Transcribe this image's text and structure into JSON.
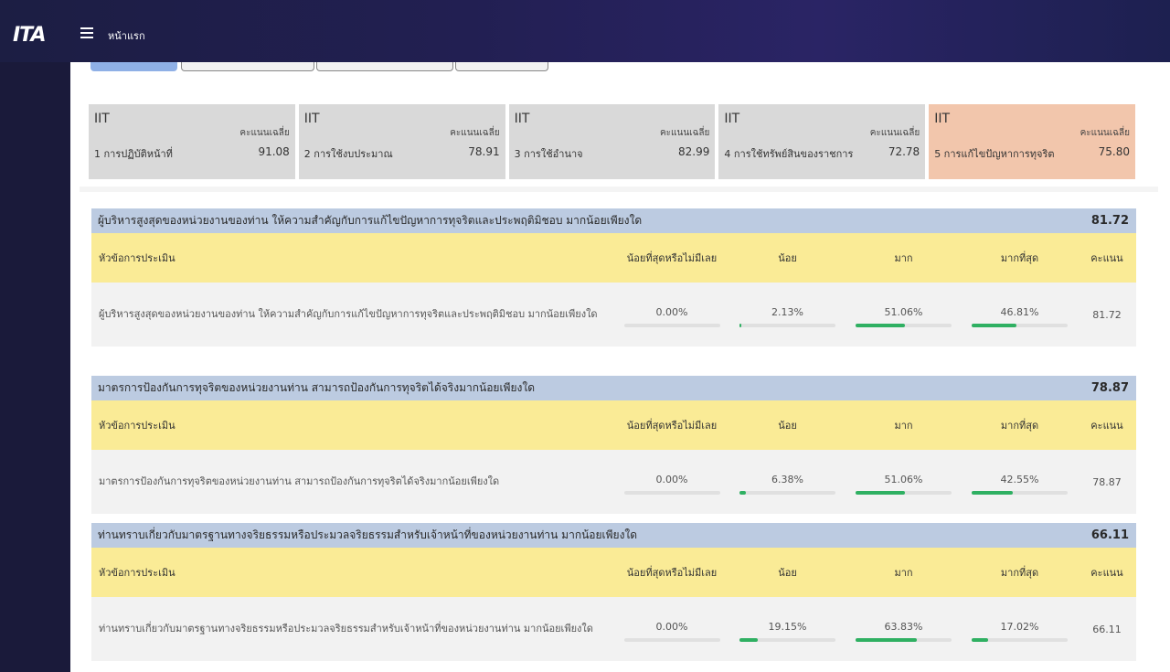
{
  "header": {
    "logo": "ITA",
    "title": "หน้าแรก"
  },
  "iit_cards": [
    {
      "title": "IIT",
      "label": "1 การปฏิบัติหน้าที่",
      "score_label": "คะแนนเฉลี่ย",
      "score": "91.08"
    },
    {
      "title": "IIT",
      "label": "2 การใช้งบประมาณ",
      "score_label": "คะแนนเฉลี่ย",
      "score": "78.91"
    },
    {
      "title": "IIT",
      "label": "3 การใช้อำนาจ",
      "score_label": "คะแนนเฉลี่ย",
      "score": "82.99"
    },
    {
      "title": "IIT",
      "label": "4 การใช้ทรัพย์สินของราชการ",
      "score_label": "คะแนนเฉลี่ย",
      "score": "72.78"
    },
    {
      "title": "IIT",
      "label": "5 การแก้ไขปัญหาการทุจริต",
      "score_label": "คะแนนเฉลี่ย",
      "score": "75.80"
    }
  ],
  "table_headers": {
    "topic": "หัวข้อการประเมิน",
    "least": "น้อยที่สุดหรือไม่มีเลย",
    "little": "น้อย",
    "much": "มาก",
    "most": "มากที่สุด",
    "score": "คะแนน"
  },
  "sections": [
    {
      "title": "ผู้บริหารสูงสุดของหน่วยงานของท่าน ให้ความสำคัญกับการแก้ไขปัญหาการทุจริตและประพฤติมิชอบ มากน้อยเพียงใด",
      "score": "81.72",
      "row": {
        "topic": "ผู้บริหารสูงสุดของหน่วยงานของท่าน ให้ความสำคัญกับการแก้ไขปัญหาการทุจริตและประพฤติมิชอบ มากน้อยเพียงใด",
        "least": "0.00%",
        "little": "2.13%",
        "much": "51.06%",
        "most": "46.81%",
        "least_value": 0.0,
        "little_value": 2.13,
        "much_value": 51.06,
        "most_value": 46.81,
        "score": "81.72"
      }
    },
    {
      "title": "มาตรการป้องกันการทุจริตของหน่วยงานท่าน สามารถป้องกันการทุจริตได้จริงมากน้อยเพียงใด",
      "score": "78.87",
      "row": {
        "topic": "มาตรการป้องกันการทุจริตของหน่วยงานท่าน สามารถป้องกันการทุจริตได้จริงมากน้อยเพียงใด",
        "least": "0.00%",
        "little": "6.38%",
        "much": "51.06%",
        "most": "42.55%",
        "least_value": 0.0,
        "little_value": 6.38,
        "much_value": 51.06,
        "most_value": 42.55,
        "score": "78.87"
      }
    },
    {
      "title": "ท่านทราบเกี่ยวกับมาตรฐานทางจริยธรรมหรือประมวลจริยธรรมสำหรับเจ้าหน้าที่ของหน่วยงานท่าน มากน้อยเพียงใด",
      "score": "66.11",
      "row": {
        "topic": "ท่านทราบเกี่ยวกับมาตรฐานทางจริยธรรมหรือประมวลจริยธรรมสำหรับเจ้าหน้าที่ของหน่วยงานท่าน มากน้อยเพียงใด",
        "least": "0.00%",
        "little": "19.15%",
        "much": "63.83%",
        "most": "17.02%",
        "least_value": 0.0,
        "little_value": 19.15,
        "much_value": 63.83,
        "most_value": 17.02,
        "score": "66.11"
      }
    }
  ],
  "colors": {
    "topbar": "#221f52",
    "section_header": "#bccbe1",
    "table_header": "#faeb96",
    "highlight_card": "#f2c6ac",
    "progress": "#2fb062"
  }
}
